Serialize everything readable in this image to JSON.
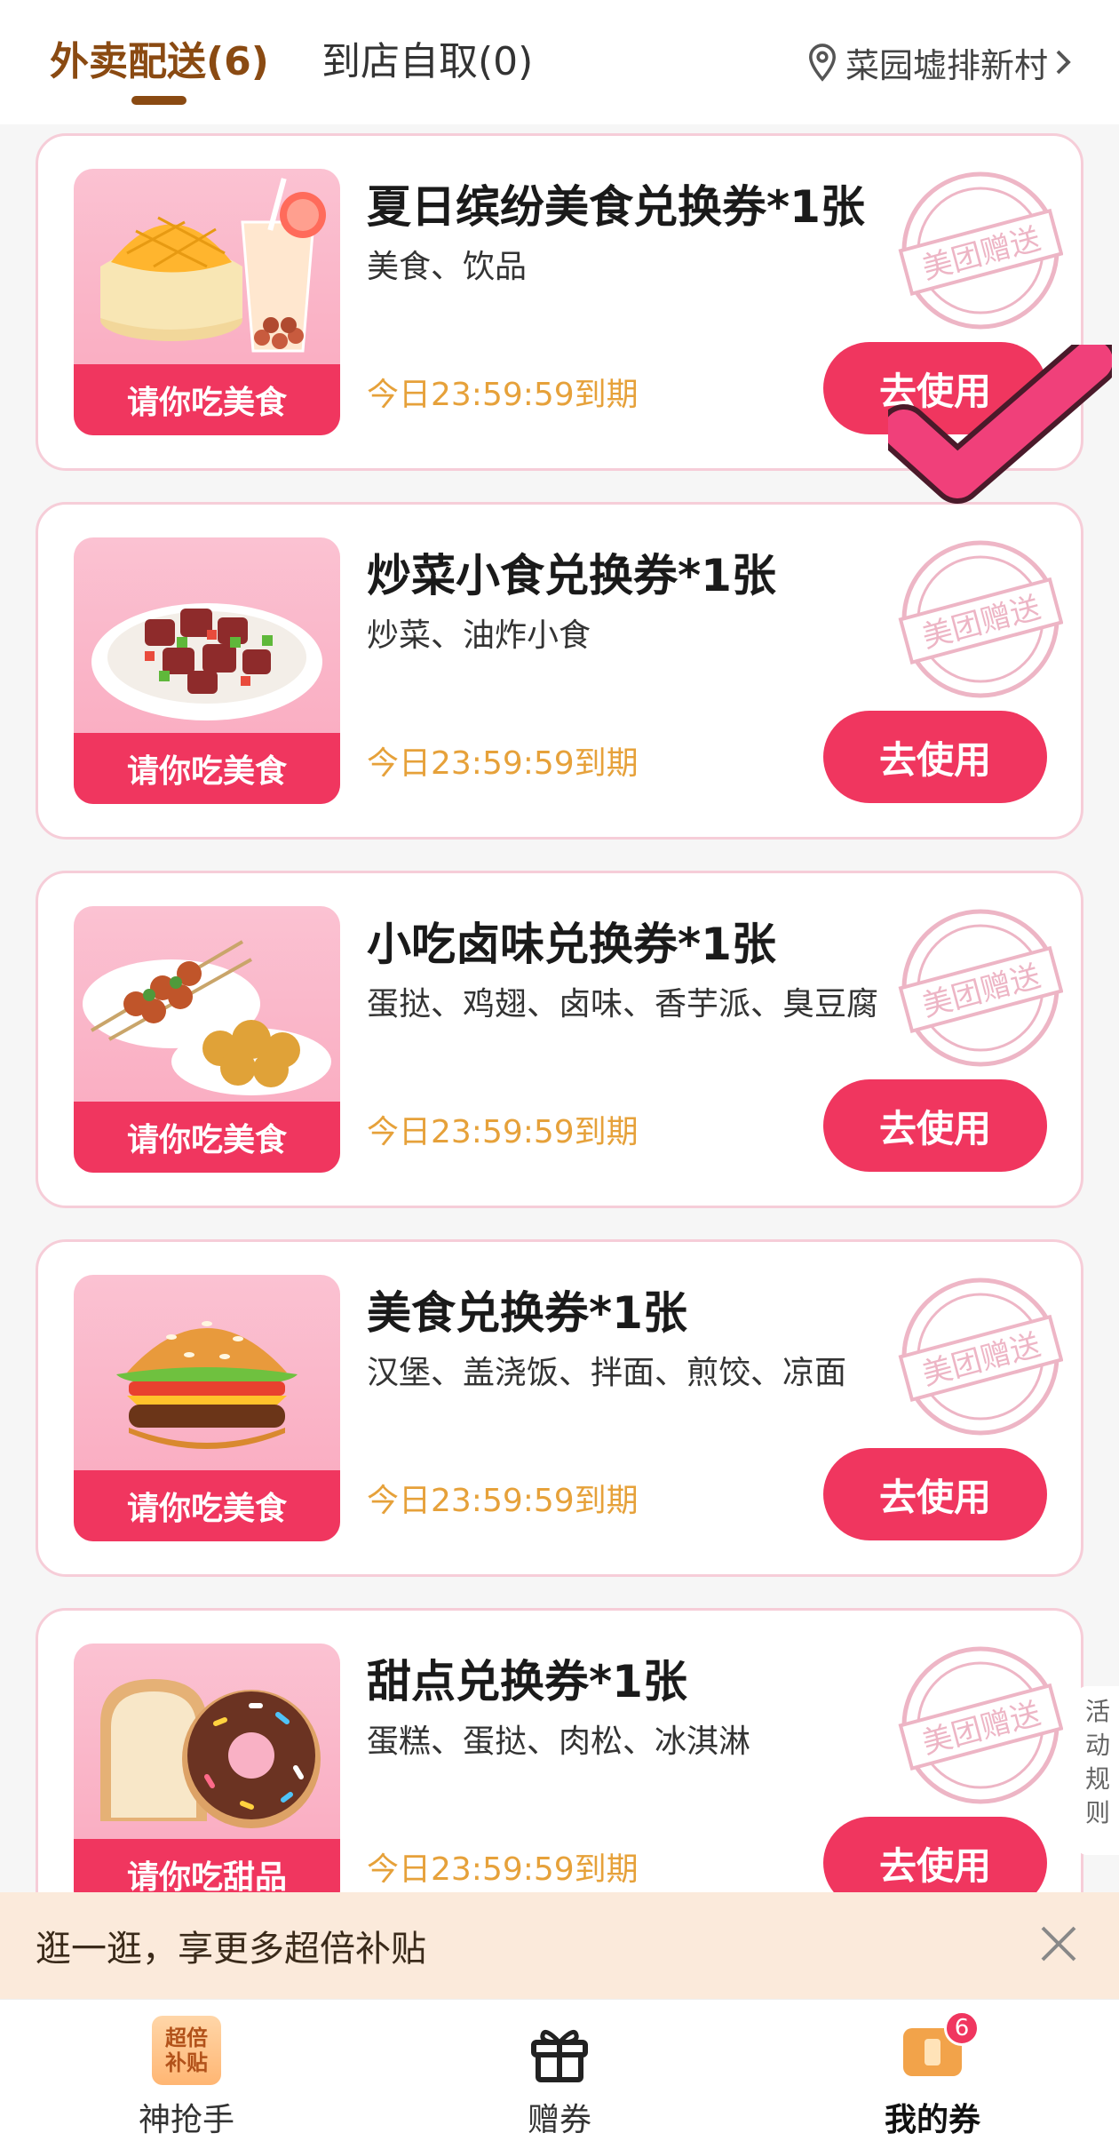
{
  "header": {
    "tabs": [
      {
        "label": "外卖配送(6)",
        "active": true
      },
      {
        "label": "到店自取(0)",
        "active": false
      }
    ],
    "location": "菜园墟排新村"
  },
  "coupons": [
    {
      "title": "夏日缤纷美食兑换券*1张",
      "items": "美食、饮品",
      "expire": "今日23:59:59到期",
      "banner": "请你吃美食",
      "button": "去使用",
      "stamp": "美团赠送",
      "image": "mango-cake-and-bubble-tea"
    },
    {
      "title": "炒菜小食兑换券*1张",
      "items": "炒菜、油炸小食",
      "expire": "今日23:59:59到期",
      "banner": "请你吃美食",
      "button": "去使用",
      "stamp": "美团赠送",
      "image": "stir-fried-beef-cubes"
    },
    {
      "title": "小吃卤味兑换券*1张",
      "items": "蛋挞、鸡翅、卤味、香芋派、臭豆腐",
      "expire": "今日23:59:59到期",
      "banner": "请你吃美食",
      "button": "去使用",
      "stamp": "美团赠送",
      "image": "skewers-and-fried-chicken"
    },
    {
      "title": "美食兑换券*1张",
      "items": "汉堡、盖浇饭、拌面、煎饺、凉面",
      "expire": "今日23:59:59到期",
      "banner": "请你吃美食",
      "button": "去使用",
      "stamp": "美团赠送",
      "image": "hamburger"
    },
    {
      "title": "甜点兑换券*1张",
      "items": "蛋糕、蛋挞、肉松、冰淇淋",
      "expire": "今日23:59:59到期",
      "banner": "请你吃甜品",
      "button": "去使用",
      "stamp": "美团赠送",
      "image": "toast-and-donut"
    }
  ],
  "side_tab": {
    "chars": [
      "活",
      "动",
      "规",
      "则"
    ]
  },
  "promo": {
    "text": "逛一逛，享更多超倍补贴",
    "close_icon": "close-icon"
  },
  "nav": {
    "items": [
      {
        "label": "神抢手",
        "icon_text": [
          "超倍",
          "补贴"
        ]
      },
      {
        "label": "赠券",
        "icon": "gift-icon"
      },
      {
        "label": "我的券",
        "icon": "coupon-icon",
        "badge": "6",
        "active": true
      }
    ]
  },
  "colors": {
    "brand_pink": "#f0365f",
    "tab_active": "#8a4a12",
    "expire_orange": "#e6a13a",
    "card_border": "#f6cdd8"
  }
}
